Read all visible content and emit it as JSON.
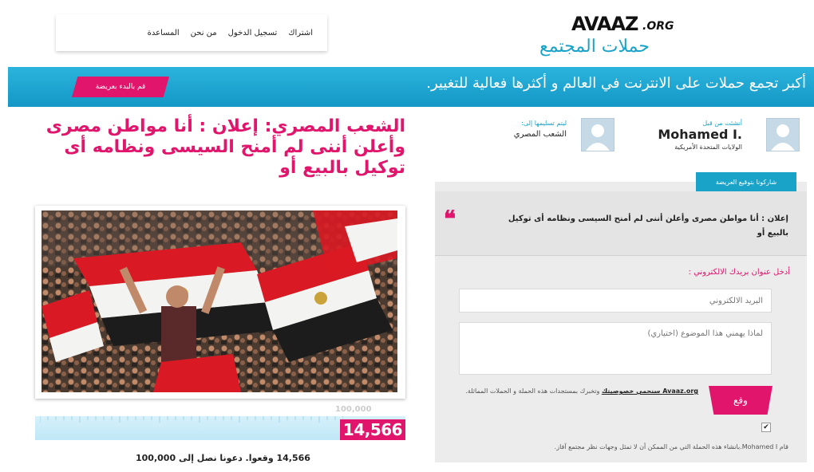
{
  "nav": {
    "items": [
      "اشتراك",
      "تسجيل الدخول",
      "من نحن",
      "المساعدة"
    ]
  },
  "logo": {
    "name": "AVAAZ",
    "suffix": ".ORG",
    "subtitle": "حملات المجتمع"
  },
  "banner": {
    "tagline": "أكبر تجمع حملات على الانترنت في العالم و أكثرها فعالية للتغيير.",
    "start_button": "قم بالبدء بعريضة"
  },
  "petition": {
    "title": "الشعب المصري: إعلان : أنا مواطن مصرى وأعلن أننى لم أمنح السيسى ونظامه أى توكيل بالبيع أو",
    "creator_label": "أنشئت من قبل",
    "creator_name": "Mohamed I.",
    "creator_location": "الولايات المتحدة الأمريكية",
    "recipient_label": "ليتم تسليمها إلى:",
    "recipient": "الشعب المصري"
  },
  "progress": {
    "goal": "100,000",
    "count": "14,566",
    "fraction": 0.14566,
    "caption": "14,566 وقعوا. دعونا نصل إلى 100,000"
  },
  "sign": {
    "tab_label": "شاركونا بتوقيع العريضة",
    "quote": "إعلان : أنا مواطن مصرى وأعلن أننى لم أمنح السيسى ونظامه أى توكيل بالبيع أو",
    "email_label": "أدخل عنوان بريدك الالكتروني :",
    "email_placeholder": "البريد الالكتروني",
    "reason_placeholder": "لماذا يهمني هذا الموضوع (اختياري)",
    "button": "وقع",
    "privacy_link": "Avaaz.org سنحمي خصوصيتك",
    "privacy_text": " وتخبرك بمستجدات هذه الحملة و الحملات المماثلة.",
    "checkbox_mark": "✔",
    "checkbox_text": "قام Mohamed I.بانشاء هذه الحملة التي من الممكن أن لا تمثل وجهات نظر مجتمع آفاز."
  },
  "colors": {
    "accent": "#e0156b",
    "banner": "#1aa3c9",
    "panel": "#ececec"
  },
  "icons": {
    "creator_avatar": "user-avatar-icon",
    "recipient_avatar": "user-avatar-icon",
    "quote": "quote-mark-icon",
    "photo": "protest-photo"
  }
}
